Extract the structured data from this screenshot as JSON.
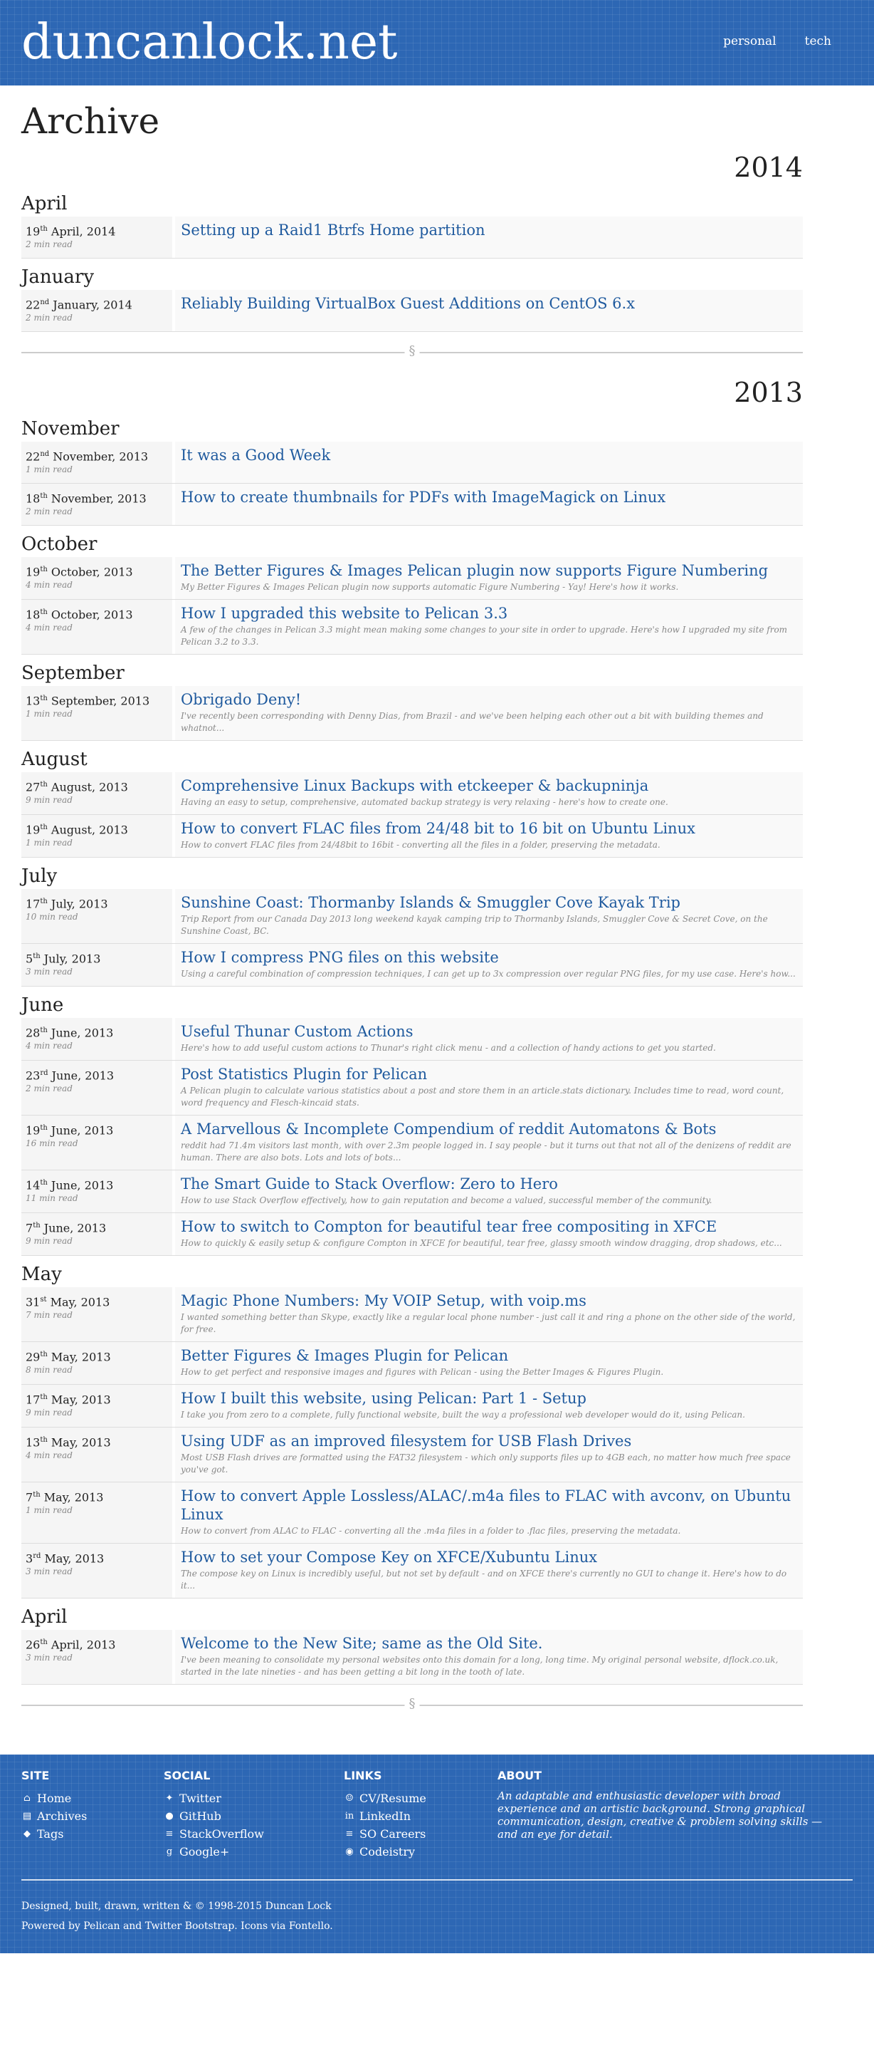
{
  "header": {
    "site_title": "duncanlock.net",
    "nav": [
      {
        "label": "personal"
      },
      {
        "label": "tech"
      }
    ]
  },
  "page_title": "Archive",
  "divider_glyph": "§",
  "years": [
    {
      "year": "2014",
      "months": [
        {
          "name": "April",
          "entries": [
            {
              "day": "19",
              "suffix": "th",
              "rest": " April, 2014",
              "read": "2 min read",
              "title": "Setting up a Raid1 Btrfs Home partition",
              "summary": ""
            }
          ]
        },
        {
          "name": "January",
          "entries": [
            {
              "day": "22",
              "suffix": "nd",
              "rest": " January, 2014",
              "read": "2 min read",
              "title": "Reliably Building VirtualBox Guest Additions on CentOS 6.x",
              "summary": ""
            }
          ]
        }
      ]
    },
    {
      "year": "2013",
      "months": [
        {
          "name": "November",
          "entries": [
            {
              "day": "22",
              "suffix": "nd",
              "rest": " November, 2013",
              "read": "1 min read",
              "title": "It was a Good Week",
              "summary": ""
            },
            {
              "day": "18",
              "suffix": "th",
              "rest": " November, 2013",
              "read": "2 min read",
              "title": "How to create thumbnails for PDFs with ImageMagick on Linux",
              "summary": ""
            }
          ]
        },
        {
          "name": "October",
          "entries": [
            {
              "day": "19",
              "suffix": "th",
              "rest": " October, 2013",
              "read": "4 min read",
              "title": "The Better Figures & Images Pelican plugin now supports Figure Numbering",
              "summary": "My Better Figures & Images Pelican plugin now supports automatic Figure Numbering - Yay! Here's how it works."
            },
            {
              "day": "18",
              "suffix": "th",
              "rest": " October, 2013",
              "read": "4 min read",
              "title": "How I upgraded this website to Pelican 3.3",
              "summary": "A few of the changes in Pelican 3.3 might mean making some changes to your site in order to upgrade. Here's how I upgraded my site from Pelican 3.2 to 3.3."
            }
          ]
        },
        {
          "name": "September",
          "entries": [
            {
              "day": "13",
              "suffix": "th",
              "rest": " September, 2013",
              "read": "1 min read",
              "title": "Obrigado Deny!",
              "summary": "I've recently been corresponding with Denny Dias, from Brazil - and we've been helping each other out a bit with building themes and whatnot..."
            }
          ]
        },
        {
          "name": "August",
          "entries": [
            {
              "day": "27",
              "suffix": "th",
              "rest": " August, 2013",
              "read": "9 min read",
              "title": "Comprehensive Linux Backups with etckeeper & backupninja",
              "summary": "Having an easy to setup, comprehensive, automated backup strategy is very relaxing - here's how to create one."
            },
            {
              "day": "19",
              "suffix": "th",
              "rest": " August, 2013",
              "read": "1 min read",
              "title": "How to convert FLAC files from 24/48 bit to 16 bit on Ubuntu Linux",
              "summary": "How to convert FLAC files from 24/48bit to 16bit - converting all the files in a folder, preserving the metadata."
            }
          ]
        },
        {
          "name": "July",
          "entries": [
            {
              "day": "17",
              "suffix": "th",
              "rest": " July, 2013",
              "read": "10 min read",
              "title": "Sunshine Coast: Thormanby Islands & Smuggler Cove Kayak Trip",
              "summary": "Trip Report from our Canada Day 2013 long weekend kayak camping trip to Thormanby Islands, Smuggler Cove & Secret Cove, on the Sunshine Coast, BC."
            },
            {
              "day": "5",
              "suffix": "th",
              "rest": " July, 2013",
              "read": "3 min read",
              "title": "How I compress PNG files on this website",
              "summary": "Using a careful combination of compression techniques, I can get up to 3x compression over regular PNG files, for my use case. Here's how..."
            }
          ]
        },
        {
          "name": "June",
          "entries": [
            {
              "day": "28",
              "suffix": "th",
              "rest": " June, 2013",
              "read": "4 min read",
              "title": "Useful Thunar Custom Actions",
              "summary": "Here's how to add useful custom actions to Thunar's right click menu - and a collection of handy actions to get you started."
            },
            {
              "day": "23",
              "suffix": "rd",
              "rest": " June, 2013",
              "read": "2 min read",
              "title": "Post Statistics Plugin for Pelican",
              "summary": "A Pelican plugin to calculate various statistics about a post and store them in an article.stats dictionary. Includes time to read, word count, word frequency and Flesch-kincaid stats."
            },
            {
              "day": "19",
              "suffix": "th",
              "rest": " June, 2013",
              "read": "16 min read",
              "title": "A Marvellous & Incomplete Compendium of reddit Automatons & Bots",
              "summary": "reddit had 71.4m visitors last month, with over 2.3m people logged in. I say people - but it turns out that not all of the denizens of reddit are human. There are also bots. Lots and lots of bots..."
            },
            {
              "day": "14",
              "suffix": "th",
              "rest": " June, 2013",
              "read": "11 min read",
              "title": "The Smart Guide to Stack Overflow: Zero to Hero",
              "summary": "How to use Stack Overflow effectively, how to gain reputation and become a valued, successful member of the community."
            },
            {
              "day": "7",
              "suffix": "th",
              "rest": " June, 2013",
              "read": "9 min read",
              "title": "How to switch to Compton for beautiful tear free compositing in XFCE",
              "summary": "How to quickly & easily setup & configure Compton in XFCE for beautiful, tear free, glassy smooth window dragging, drop shadows, etc..."
            }
          ]
        },
        {
          "name": "May",
          "entries": [
            {
              "day": "31",
              "suffix": "st",
              "rest": " May, 2013",
              "read": "7 min read",
              "title": "Magic Phone Numbers: My VOIP Setup, with voip.ms",
              "summary": "I wanted something better than Skype, exactly like a regular local phone number - just call it and ring a phone on the other side of the world, for free."
            },
            {
              "day": "29",
              "suffix": "th",
              "rest": " May, 2013",
              "read": "8 min read",
              "title": "Better Figures & Images Plugin for Pelican",
              "summary": "How to get perfect and responsive images and figures with Pelican - using the Better Images & Figures Plugin."
            },
            {
              "day": "17",
              "suffix": "th",
              "rest": " May, 2013",
              "read": "9 min read",
              "title": "How I built this website, using Pelican: Part 1 - Setup",
              "summary": "I take you from zero to a complete, fully functional website, built the way a professional web developer would do it, using Pelican."
            },
            {
              "day": "13",
              "suffix": "th",
              "rest": " May, 2013",
              "read": "4 min read",
              "title": "Using UDF as an improved filesystem for USB Flash Drives",
              "summary": "Most USB Flash drives are formatted using the FAT32 filesystem - which only supports files up to 4GB each, no matter how much free space you've got."
            },
            {
              "day": "7",
              "suffix": "th",
              "rest": " May, 2013",
              "read": "1 min read",
              "title": "How to convert Apple Lossless/ALAC/.m4a files to FLAC with avconv, on Ubuntu Linux",
              "summary": "How to convert from ALAC to FLAC - converting all the .m4a files in a folder to .flac files, preserving the metadata."
            },
            {
              "day": "3",
              "suffix": "rd",
              "rest": " May, 2013",
              "read": "3 min read",
              "title": "How to set your Compose Key on XFCE/Xubuntu Linux",
              "summary": "The compose key on Linux is incredibly useful, but not set by default - and on XFCE there's currently no GUI to change it. Here's how to do it..."
            }
          ]
        },
        {
          "name": "April",
          "entries": [
            {
              "day": "26",
              "suffix": "th",
              "rest": " April, 2013",
              "read": "3 min read",
              "title": "Welcome to the New Site; same as the Old Site.",
              "summary": "I've been meaning to consolidate my personal websites onto this domain for a long, long time. My original personal website, dflock.co.uk, started in the late nineties - and has been getting a bit long in the tooth of late."
            }
          ]
        }
      ]
    }
  ],
  "footer": {
    "site": {
      "heading": "SITE",
      "links": [
        {
          "icon": "home-icon",
          "glyph": "⌂",
          "label": "Home"
        },
        {
          "icon": "archive-icon",
          "glyph": "▤",
          "label": "Archives"
        },
        {
          "icon": "tags-icon",
          "glyph": "◆",
          "label": "Tags"
        }
      ]
    },
    "social": {
      "heading": "SOCIAL",
      "links": [
        {
          "icon": "twitter-icon",
          "glyph": "✦",
          "label": "Twitter"
        },
        {
          "icon": "github-icon",
          "glyph": "●",
          "label": "GitHub"
        },
        {
          "icon": "stackoverflow-icon",
          "glyph": "≡",
          "label": "StackOverflow"
        },
        {
          "icon": "googleplus-icon",
          "glyph": "g",
          "label": "Google+"
        }
      ]
    },
    "links": {
      "heading": "LINKS",
      "links": [
        {
          "icon": "user-icon",
          "glyph": "☺",
          "label": "CV/Resume"
        },
        {
          "icon": "linkedin-icon",
          "glyph": "in",
          "label": "LinkedIn"
        },
        {
          "icon": "careers-icon",
          "glyph": "≡",
          "label": "SO Careers"
        },
        {
          "icon": "codeistry-icon",
          "glyph": "◉",
          "label": "Codeistry"
        }
      ]
    },
    "about": {
      "heading": "ABOUT",
      "text": "An adaptable and enthusiastic developer with broad experience and an artistic background. Strong graphical communication, design, creative & problem solving skills — and an eye for detail."
    },
    "credit_line_1": "Designed, built, drawn, written & © 1998-2015 Duncan Lock",
    "credit_line_2": "Powered by Pelican and Twitter Bootstrap. Icons via Fontello."
  },
  "colors": {
    "blueprint": "#2d67b4",
    "link": "#1f5a9e"
  }
}
